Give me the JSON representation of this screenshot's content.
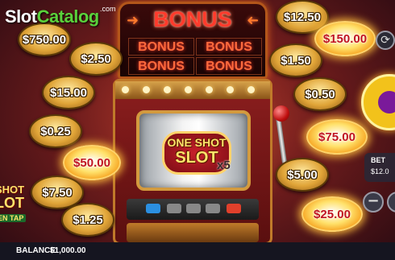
{
  "watermark": {
    "word1": "Slot",
    "word2": "Catalog",
    "suffix": ".com"
  },
  "bonus_sign": {
    "title": "BONUS",
    "cells": [
      "BONUS",
      "BONUS",
      "BONUS",
      "BONUS"
    ]
  },
  "slot_symbol": {
    "line1": "ONE SHOT",
    "line2": "SLOT",
    "multiplier": "x5"
  },
  "coins": {
    "left": [
      {
        "value": "$750.00",
        "highlighted": false
      },
      {
        "value": "$2.50",
        "highlighted": false
      },
      {
        "value": "$15.00",
        "highlighted": false
      },
      {
        "value": "$0.25",
        "highlighted": false
      },
      {
        "value": "$50.00",
        "highlighted": true
      },
      {
        "value": "$7.50",
        "highlighted": false
      },
      {
        "value": "$1.25",
        "highlighted": false
      }
    ],
    "right": [
      {
        "value": "$12.50",
        "highlighted": false
      },
      {
        "value": "$150.00",
        "highlighted": true
      },
      {
        "value": "$1.50",
        "highlighted": false
      },
      {
        "value": "$0.50",
        "highlighted": false
      },
      {
        "value": "$75.00",
        "highlighted": true
      },
      {
        "value": "$5.00",
        "highlighted": false
      },
      {
        "value": "$25.00",
        "highlighted": true
      }
    ]
  },
  "game_logo": {
    "line1": "SHOT",
    "line2": "LOT",
    "tag": "EN TAP"
  },
  "controls": {
    "settings_icon": "settings-icon",
    "spin_icon": "spin-icon",
    "bet_label": "BET",
    "bet_value": "$12.0",
    "minus_label": "−"
  },
  "footer": {
    "balance_label": "BALANCE:",
    "balance_value": "$1,000.00"
  },
  "colors": {
    "accent_gold": "#f2c21b",
    "bonus_red": "#ff3b2c",
    "highlight_value": "#c01420"
  }
}
